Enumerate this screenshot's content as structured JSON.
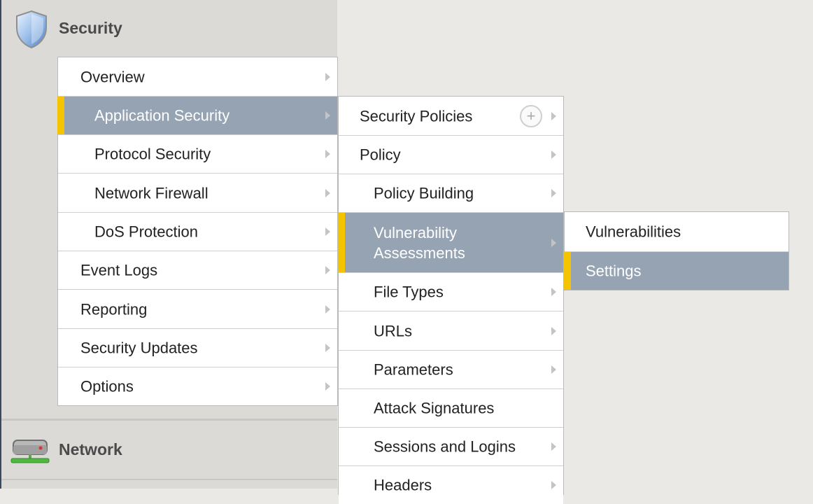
{
  "sidebar": {
    "security_header": {
      "label": "Security",
      "icon": "shield-icon"
    },
    "network_header": {
      "label": "Network",
      "icon": "network-drive-icon"
    }
  },
  "menu_level1": {
    "items": [
      {
        "label": "Overview"
      },
      {
        "label": "Application Security",
        "selected": true
      },
      {
        "label": "Protocol Security"
      },
      {
        "label": "Network Firewall"
      },
      {
        "label": "DoS Protection"
      },
      {
        "label": "Event Logs"
      },
      {
        "label": "Reporting"
      },
      {
        "label": "Security Updates"
      },
      {
        "label": "Options"
      }
    ]
  },
  "menu_level2": {
    "items": [
      {
        "label": "Security Policies",
        "icon": "add-circle-icon"
      },
      {
        "label": "Policy"
      },
      {
        "label": "Policy Building"
      },
      {
        "label": "Vulnerability Assessments",
        "selected": true
      },
      {
        "label": "File Types"
      },
      {
        "label": "URLs"
      },
      {
        "label": "Parameters"
      },
      {
        "label": "Attack Signatures"
      },
      {
        "label": "Sessions and Logins"
      },
      {
        "label": "Headers"
      }
    ]
  },
  "menu_level3": {
    "items": [
      {
        "label": "Vulnerabilities"
      },
      {
        "label": "Settings",
        "selected": true
      }
    ]
  },
  "colors": {
    "selected_bg": "#96a3b3",
    "selected_marker": "#f5c400",
    "sidebar_bg": "#dcdad6",
    "page_bg": "#ebe9e6"
  }
}
